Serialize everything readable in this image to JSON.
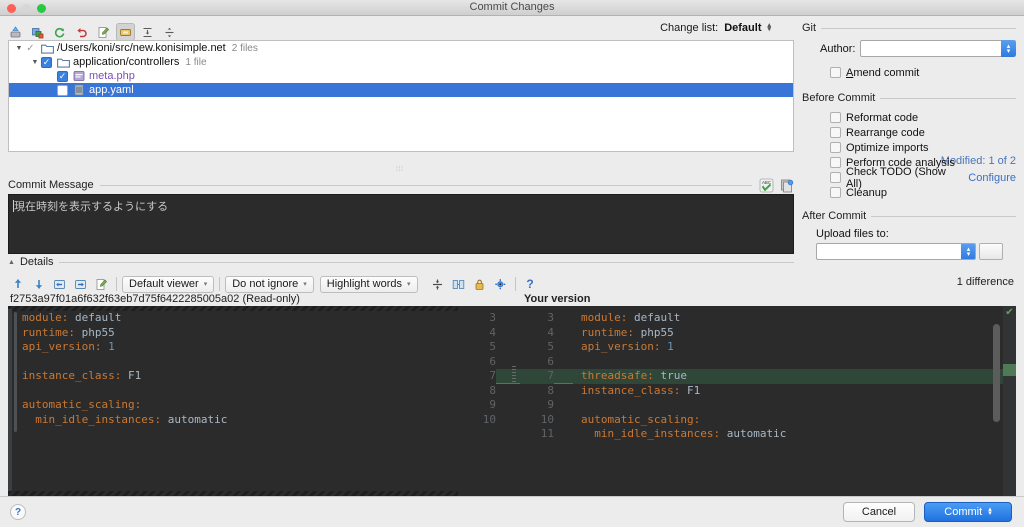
{
  "window": {
    "title": "Commit Changes",
    "traffic_lights": [
      "close-red",
      "minimize-disabled",
      "zoom-green"
    ]
  },
  "toolbar": {
    "icons": [
      {
        "name": "commit-icon",
        "glyph": "⤒"
      },
      {
        "name": "revert-selected-icon",
        "glyph": "▣"
      },
      {
        "name": "refresh-icon",
        "glyph": "↻"
      },
      {
        "name": "rollback-icon",
        "glyph": "↩"
      },
      {
        "name": "show-diff-icon",
        "glyph": "✎"
      },
      {
        "name": "group-by-directory-icon",
        "glyph": "▭"
      },
      {
        "name": "expand-all-icon",
        "glyph": "↧"
      },
      {
        "name": "collapse-all-icon",
        "glyph": "↥"
      }
    ]
  },
  "change_list": {
    "label": "Change list:",
    "value": "Default"
  },
  "file_tree": {
    "rows": [
      {
        "indent": 0,
        "twisty": "▼",
        "check_state": "partial",
        "icon": "folder-icon",
        "label": "/Users/koni/src/new.konisimple.net",
        "count": "2 files",
        "modified": false,
        "selected": false
      },
      {
        "indent": 1,
        "twisty": "▼",
        "check_state": "checked",
        "icon": "folder-icon",
        "label": "application/controllers",
        "count": "1 file",
        "modified": false,
        "selected": false
      },
      {
        "indent": 2,
        "twisty": "",
        "check_state": "checked",
        "icon": "php-file-icon",
        "label": "meta.php",
        "count": "",
        "modified": true,
        "selected": false
      },
      {
        "indent": 2,
        "twisty": "",
        "check_state": "unchecked",
        "icon": "yaml-file-icon",
        "label": "app.yaml",
        "count": "",
        "modified": false,
        "selected": true
      }
    ],
    "modified_note": "Modified: 1 of 2"
  },
  "commit_message": {
    "section_title": "Commit Message",
    "text": "現在時刻を表示するようにする",
    "icons": [
      {
        "name": "spellcheck-icon",
        "glyph": "ABC"
      },
      {
        "name": "commit-history-icon",
        "glyph": "⎘"
      }
    ]
  },
  "details": {
    "label": "Details",
    "twisty": "▲"
  },
  "git_section": {
    "title": "Git",
    "author_label": "Author:",
    "author_value": "",
    "amend_commit_label": "Amend commit",
    "amend_commit_checked": false
  },
  "before_commit": {
    "title": "Before Commit",
    "items": [
      {
        "label": "Reformat code",
        "checked": false,
        "link": ""
      },
      {
        "label": "Rearrange code",
        "checked": false,
        "link": ""
      },
      {
        "label": "Optimize imports",
        "checked": false,
        "link": ""
      },
      {
        "label": "Perform code analysis",
        "checked": false,
        "link": ""
      },
      {
        "label": "Check TODO (Show All)",
        "checked": false,
        "link": "Configure"
      },
      {
        "label": "Cleanup",
        "checked": false,
        "link": ""
      }
    ]
  },
  "after_commit": {
    "title": "After Commit",
    "upload_label": "Upload files to:",
    "upload_value": ""
  },
  "diff_toolbar": {
    "nav_icons": [
      {
        "name": "previous-difference-icon",
        "glyph": "↑"
      },
      {
        "name": "next-difference-icon",
        "glyph": "↓"
      },
      {
        "name": "apply-left-icon",
        "glyph": "⇤"
      },
      {
        "name": "apply-right-icon",
        "glyph": "⇥"
      },
      {
        "name": "edit-source-icon",
        "glyph": "✎"
      }
    ],
    "dropdowns": [
      {
        "name": "viewer-select",
        "label": "Default viewer"
      },
      {
        "name": "ignore-policy-select",
        "label": "Do not ignore"
      },
      {
        "name": "highlight-mode-select",
        "label": "Highlight words"
      }
    ],
    "toggle_icons": [
      {
        "name": "collapse-unchanged-icon",
        "glyph": "⤓"
      },
      {
        "name": "synchronize-scrolling-icon",
        "glyph": "▦"
      },
      {
        "name": "read-only-lock-icon",
        "glyph": "🔒"
      },
      {
        "name": "settings-gear-icon",
        "glyph": "⚙"
      },
      {
        "name": "help-icon",
        "glyph": "?"
      }
    ],
    "difference_count": "1 difference"
  },
  "diff": {
    "left_title": "f2753a97f01a6f632f63eb7d75f6422285005a02 (Read-only)",
    "right_title": "Your version",
    "left_lines": [
      {
        "num": "3",
        "text": "module: default",
        "type": "normal"
      },
      {
        "num": "4",
        "text": "runtime: php55",
        "type": "normal"
      },
      {
        "num": "5",
        "text": "api_version: 1",
        "type": "normal"
      },
      {
        "num": "6",
        "text": "",
        "type": "normal"
      },
      {
        "num": "7",
        "text": "instance_class: F1",
        "type": "normal"
      },
      {
        "num": "8",
        "text": "",
        "type": "normal"
      },
      {
        "num": "9",
        "text": "automatic_scaling:",
        "type": "normal"
      },
      {
        "num": "10",
        "text": "  min_idle_instances: automatic",
        "type": "normal"
      }
    ],
    "right_lines": [
      {
        "num": "3",
        "text": "module: default",
        "type": "normal"
      },
      {
        "num": "4",
        "text": "runtime: php55",
        "type": "normal"
      },
      {
        "num": "5",
        "text": "api_version: 1",
        "type": "normal"
      },
      {
        "num": "6",
        "text": "",
        "type": "normal"
      },
      {
        "num": "7",
        "text": "threadsafe: true",
        "type": "added"
      },
      {
        "num": "8",
        "text": "instance_class: F1",
        "type": "normal"
      },
      {
        "num": "9",
        "text": "",
        "type": "normal"
      },
      {
        "num": "10",
        "text": "automatic_scaling:",
        "type": "normal"
      },
      {
        "num": "11",
        "text": "  min_idle_instances: automatic",
        "type": "normal"
      }
    ],
    "added_color": "#2f4739",
    "key_color": "#cc7832",
    "value_color": "#a9b7c6",
    "background": "#2b2b2b"
  },
  "footer": {
    "help_glyph": "?",
    "cancel_label": "Cancel",
    "commit_label": "Commit"
  }
}
